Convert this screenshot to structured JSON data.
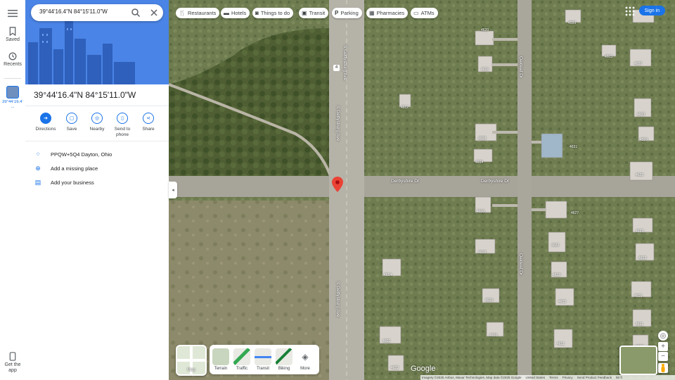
{
  "search": {
    "query": "39°44'16.4\"N 84°15'11.0\"W"
  },
  "rail": {
    "saved": "Saved",
    "recents": "Recents",
    "recent_item": "39°44'16.4\"N ...",
    "get_app": "Get the app"
  },
  "place": {
    "title": "39°44'16.4\"N 84°15'11.0\"W",
    "actions": [
      "Directions",
      "Save",
      "Nearby",
      "Send to phone",
      "Share"
    ],
    "plus_code": "PPQW+5Q4 Dayton, Ohio",
    "add_missing": "Add a missing place",
    "add_business": "Add your business"
  },
  "chips": [
    "Restaurants",
    "Hotels",
    "Things to do",
    "Transit",
    "Parking",
    "Pharmacies",
    "ATMs"
  ],
  "header": {
    "signin": "Sign in"
  },
  "layers": {
    "map_toggle": "Map",
    "items": [
      "Terrain",
      "Traffic",
      "Transit",
      "Biking",
      "More"
    ]
  },
  "map_labels": {
    "street_vertical": "S Gettysburg Ave",
    "street_derbyshire": "Derbyshire Dr",
    "street_oakleaf": "Oakleaf Dr",
    "road_marker": "4"
  },
  "house_numbers": [
    "4620",
    "4616",
    "4612",
    "4608",
    "4604",
    "4600",
    "4618",
    "4614",
    "4610",
    "4606",
    "4602",
    "4622",
    "4631",
    "4627",
    "4623",
    "4619",
    "4615",
    "4611",
    "4607",
    "4603",
    "4599",
    "4626",
    "4623",
    "4619",
    "4615",
    "4611",
    "4607",
    "4603",
    "4599"
  ],
  "attribution": {
    "imagery": "Imagery ©2025 Airbus, Maxar Technologies, Map data ©2025 Google",
    "country": "United States",
    "terms": "Terms",
    "privacy": "Privacy",
    "feedback": "Send Product Feedback",
    "scale": "50 ft"
  },
  "logo": "Google",
  "icons": {
    "menu": "menu-icon",
    "search": "search-icon",
    "close": "close-icon",
    "saved": "bookmark-icon",
    "recents": "history-icon",
    "pin": "location-pin-icon",
    "apps": "apps-grid-icon",
    "location": "my-location-icon",
    "zoom_in": "plus-icon",
    "zoom_out": "minus-icon",
    "pegman": "pegman-icon"
  },
  "colors": {
    "accent": "#1a73e8",
    "pin": "#ea4335",
    "panel_hero": "#4a84e6"
  }
}
